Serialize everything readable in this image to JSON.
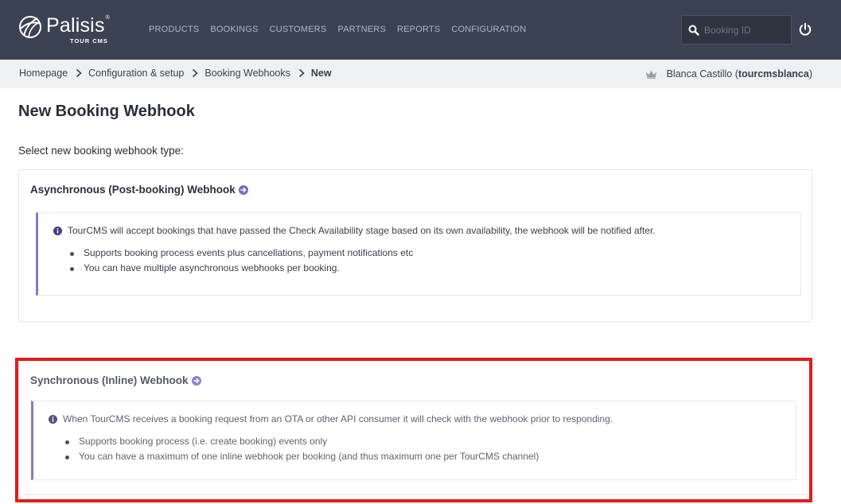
{
  "brand": {
    "name": "Palisis",
    "tm": "®",
    "sub": "TOUR CMS"
  },
  "nav": {
    "items": [
      "PRODUCTS",
      "BOOKINGS",
      "CUSTOMERS",
      "PARTNERS",
      "REPORTS",
      "CONFIGURATION"
    ]
  },
  "search": {
    "placeholder": "Booking ID",
    "value": ""
  },
  "breadcrumb": {
    "items": [
      "Homepage",
      "Configuration & setup",
      "Booking Webhooks"
    ],
    "current": "New"
  },
  "user": {
    "name": "Blanca Castillo (",
    "handle": "tourcmsblanca",
    "close": ")"
  },
  "page": {
    "title": "New Booking Webhook",
    "subtitle": "Select new booking webhook type:"
  },
  "webhooks": [
    {
      "title": "Asynchronous (Post-booking) Webhook",
      "description": "TourCMS will accept bookings that have passed the Check Availability stage based on its own availability, the webhook will be notified after.",
      "bullets": [
        "Supports booking process events plus cancellations, payment notifications etc",
        "You can have multiple asynchronous webhooks per booking."
      ]
    },
    {
      "title": "Synchronous (Inline) Webhook",
      "description": "When TourCMS receives a booking request from an OTA or other API consumer it will check with the webhook prior to responding.",
      "bullets": [
        "Supports booking process (i.e. create booking) events only",
        "You can have a maximum of one inline webhook per booking (and thus maximum one per TourCMS channel)"
      ]
    }
  ],
  "colors": {
    "topbar": "#3b4252",
    "accent": "#7b68c4",
    "highlight": "#e31b1b",
    "crumbbar": "#eef0f2"
  },
  "icons": {
    "logo": "palisis-globe-icon",
    "search": "search-icon",
    "power": "power-icon",
    "crown": "crown-icon",
    "info": "info-icon",
    "arrow": "arrow-circle-right-icon",
    "crumb_sep": "chevron-right-icon"
  }
}
